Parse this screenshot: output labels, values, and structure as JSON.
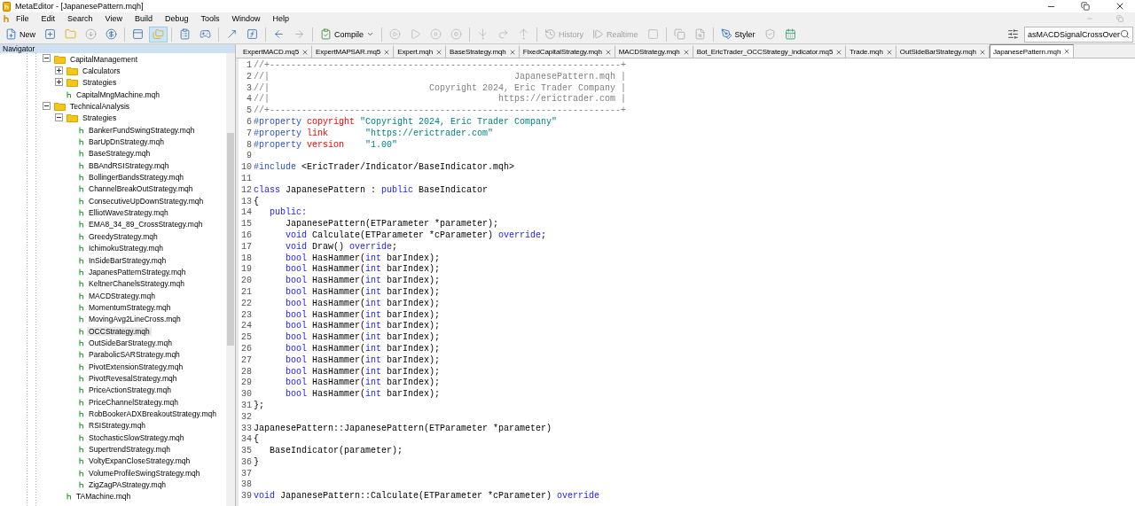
{
  "window": {
    "title": "MetaEditor - [JapanesePattern.mqh]"
  },
  "menu": [
    "File",
    "Edit",
    "Search",
    "View",
    "Build",
    "Debug",
    "Tools",
    "Window",
    "Help"
  ],
  "toolbar": {
    "navigator_pressed": true,
    "buttons": [
      {
        "label": "New",
        "disabled": false
      },
      {
        "label": "Compile",
        "disabled": false
      },
      {
        "label": "History",
        "disabled": true
      },
      {
        "label": "Realtime",
        "disabled": true
      },
      {
        "label": "Styler",
        "disabled": false
      }
    ],
    "search": {
      "value": "asMACDSignalCrossOver"
    }
  },
  "navigator": {
    "title": "Navigator",
    "tree": [
      {
        "kind": "folder",
        "label": "CapitalManagement",
        "expanded": true,
        "selected": false,
        "children": [
          {
            "kind": "folder",
            "label": "Calculators",
            "expanded": false,
            "selected": false
          },
          {
            "kind": "folder",
            "label": "Strategies",
            "expanded": false,
            "selected": false
          },
          {
            "kind": "file",
            "label": "CapitalMngMachine.mqh",
            "selected": false
          }
        ]
      },
      {
        "kind": "folder",
        "label": "TechnicalAnalysis",
        "expanded": true,
        "selected": false,
        "children": [
          {
            "kind": "folder",
            "label": "Strategies",
            "expanded": true,
            "selected": false,
            "children": [
              {
                "kind": "file",
                "label": "BankerFundSwingStrategy.mqh",
                "selected": false
              },
              {
                "kind": "file",
                "label": "BarUpDnStrategy.mqh",
                "selected": false
              },
              {
                "kind": "file",
                "label": "BaseStrategy.mqh",
                "selected": false
              },
              {
                "kind": "file",
                "label": "BBAndRSIStrategy.mqh",
                "selected": false
              },
              {
                "kind": "file",
                "label": "BollingerBandsStrategy.mqh",
                "selected": false
              },
              {
                "kind": "file",
                "label": "ChannelBreakOutStrategy.mqh",
                "selected": false
              },
              {
                "kind": "file",
                "label": "ConsecutiveUpDownStrategy.mqh",
                "selected": false
              },
              {
                "kind": "file",
                "label": "ElliotWaveStrategy.mqh",
                "selected": false
              },
              {
                "kind": "file",
                "label": "EMA8_34_89_CrossStrategy.mqh",
                "selected": false
              },
              {
                "kind": "file",
                "label": "GreedyStrategy.mqh",
                "selected": false
              },
              {
                "kind": "file",
                "label": "IchimokuStrategy.mqh",
                "selected": false
              },
              {
                "kind": "file",
                "label": "InSideBarStrategy.mqh",
                "selected": false
              },
              {
                "kind": "file",
                "label": "JapanesPatternStrategy.mqh",
                "selected": false
              },
              {
                "kind": "file",
                "label": "KeltnerChanelsStrategy.mqh",
                "selected": false
              },
              {
                "kind": "file",
                "label": "MACDStrategy.mqh",
                "selected": false
              },
              {
                "kind": "file",
                "label": "MomentumStrategy.mqh",
                "selected": false
              },
              {
                "kind": "file",
                "label": "MovingAvg2LineCross.mqh",
                "selected": false
              },
              {
                "kind": "file",
                "label": "OCCStrategy.mqh",
                "selected": true
              },
              {
                "kind": "file",
                "label": "OutSideBarStrategy.mqh",
                "selected": false
              },
              {
                "kind": "file",
                "label": "ParabolicSARStrategy.mqh",
                "selected": false
              },
              {
                "kind": "file",
                "label": "PivotExtensionStrategy.mqh",
                "selected": false
              },
              {
                "kind": "file",
                "label": "PivotRevesalStrategy.mqh",
                "selected": false
              },
              {
                "kind": "file",
                "label": "PriceActionStrategy.mqh",
                "selected": false
              },
              {
                "kind": "file",
                "label": "PriceChannelStrategy.mqh",
                "selected": false
              },
              {
                "kind": "file",
                "label": "RobBookerADXBreakoutStrategy.mqh",
                "selected": false
              },
              {
                "kind": "file",
                "label": "RSIStrategy.mqh",
                "selected": false
              },
              {
                "kind": "file",
                "label": "StochasticSlowStrategy.mqh",
                "selected": false
              },
              {
                "kind": "file",
                "label": "SupertrendStrategy.mqh",
                "selected": false
              },
              {
                "kind": "file",
                "label": "VoltyExpanCloseStrategy.mqh",
                "selected": false
              },
              {
                "kind": "file",
                "label": "VolumeProfileSwingStrategy.mqh",
                "selected": false
              },
              {
                "kind": "file",
                "label": "ZigZagPAStrategy.mqh",
                "selected": false
              }
            ]
          },
          {
            "kind": "file",
            "label": "TAMachine.mqh",
            "selected": false
          }
        ]
      }
    ]
  },
  "tabs": [
    {
      "label": "ExpertMACD.mq5",
      "selected": false
    },
    {
      "label": "ExpertMAPSAR.mq5",
      "selected": false
    },
    {
      "label": "Expert.mqh",
      "selected": false
    },
    {
      "label": "BaseStrategy.mqh",
      "selected": false
    },
    {
      "label": "FixedCapitalStrategy.mqh",
      "selected": false
    },
    {
      "label": "MACDStrategy.mqh",
      "selected": false
    },
    {
      "label": "Bot_EricTrader_OCCStrategy_indicator.mq5",
      "selected": false
    },
    {
      "label": "Trade.mqh",
      "selected": false
    },
    {
      "label": "OutSideBarStrategy.mqh",
      "selected": false
    },
    {
      "label": "JapanesePattern.mqh",
      "selected": true
    }
  ],
  "code": [
    {
      "number": "1",
      "tokens": [
        {
          "kind": "comment",
          "text": "//+------------------------------------------------------------------+"
        }
      ]
    },
    {
      "number": "2",
      "tokens": [
        {
          "kind": "comment",
          "text": "//|                                              JapanesePattern.mqh |"
        }
      ]
    },
    {
      "number": "3",
      "tokens": [
        {
          "kind": "comment",
          "text": "//|                              Copyright 2024, Eric Trader Company |"
        }
      ]
    },
    {
      "number": "4",
      "tokens": [
        {
          "kind": "comment",
          "text": "//|                                           https://erictrader.com |"
        }
      ]
    },
    {
      "number": "5",
      "tokens": [
        {
          "kind": "comment",
          "text": "//+------------------------------------------------------------------+"
        }
      ]
    },
    {
      "number": "6",
      "tokens": [
        {
          "kind": "preproc",
          "text": "#property"
        },
        {
          "kind": "name",
          "text": " copyright "
        },
        {
          "kind": "string",
          "text": "\"Copyright 2024, Eric Trader Company\""
        }
      ]
    },
    {
      "number": "7",
      "tokens": [
        {
          "kind": "preproc",
          "text": "#property"
        },
        {
          "kind": "name",
          "text": " link       "
        },
        {
          "kind": "string",
          "text": "\"https://erictrader.com\""
        }
      ]
    },
    {
      "number": "8",
      "tokens": [
        {
          "kind": "preproc",
          "text": "#property"
        },
        {
          "kind": "name",
          "text": " version    "
        },
        {
          "kind": "string",
          "text": "\"1.00\""
        }
      ]
    },
    {
      "number": "9"
    },
    {
      "number": "10",
      "tokens": [
        {
          "kind": "preproc",
          "text": "#include"
        },
        {
          "kind": "plain",
          "text": " <EricTrader/Indicator/BaseIndicator.mqh>"
        }
      ]
    },
    {
      "number": "11"
    },
    {
      "number": "12",
      "tokens": [
        {
          "kind": "keyword",
          "text": "class"
        },
        {
          "kind": "plain",
          "text": " JapanesePattern : "
        },
        {
          "kind": "keyword",
          "text": "public"
        },
        {
          "kind": "plain",
          "text": " BaseIndicator"
        }
      ]
    },
    {
      "number": "13",
      "tokens": [
        {
          "kind": "plain",
          "text": "{"
        }
      ]
    },
    {
      "number": "14",
      "tokens": [
        {
          "kind": "keyword",
          "text": "   public:"
        }
      ]
    },
    {
      "number": "15",
      "tokens": [
        {
          "kind": "plain",
          "text": "      JapanesePattern(ETParameter *parameter);"
        }
      ]
    },
    {
      "number": "16",
      "tokens": [
        {
          "kind": "keyword",
          "text": "      void"
        },
        {
          "kind": "plain",
          "text": " Calculate(ETParameter *cParameter) "
        },
        {
          "kind": "keyword",
          "text": "override"
        },
        {
          "kind": "plain",
          "text": ";"
        }
      ]
    },
    {
      "number": "17",
      "tokens": [
        {
          "kind": "keyword",
          "text": "      void"
        },
        {
          "kind": "plain",
          "text": " Draw() "
        },
        {
          "kind": "keyword",
          "text": "override"
        },
        {
          "kind": "plain",
          "text": ";"
        }
      ]
    },
    {
      "number": "18",
      "tokens": [
        {
          "kind": "keyword",
          "text": "      bool"
        },
        {
          "kind": "plain",
          "text": " HasHammer("
        },
        {
          "kind": "keyword",
          "text": "int"
        },
        {
          "kind": "plain",
          "text": " barIndex);"
        }
      ]
    },
    {
      "number": "19",
      "tokens": [
        {
          "kind": "keyword",
          "text": "      bool"
        },
        {
          "kind": "plain",
          "text": " HasHammer("
        },
        {
          "kind": "keyword",
          "text": "int"
        },
        {
          "kind": "plain",
          "text": " barIndex);"
        }
      ]
    },
    {
      "number": "20",
      "tokens": [
        {
          "kind": "keyword",
          "text": "      bool"
        },
        {
          "kind": "plain",
          "text": " HasHammer("
        },
        {
          "kind": "keyword",
          "text": "int"
        },
        {
          "kind": "plain",
          "text": " barIndex);"
        }
      ]
    },
    {
      "number": "21",
      "tokens": [
        {
          "kind": "keyword",
          "text": "      bool"
        },
        {
          "kind": "plain",
          "text": " HasHammer("
        },
        {
          "kind": "keyword",
          "text": "int"
        },
        {
          "kind": "plain",
          "text": " barIndex);"
        }
      ]
    },
    {
      "number": "22",
      "tokens": [
        {
          "kind": "keyword",
          "text": "      bool"
        },
        {
          "kind": "plain",
          "text": " HasHammer("
        },
        {
          "kind": "keyword",
          "text": "int"
        },
        {
          "kind": "plain",
          "text": " barIndex);"
        }
      ]
    },
    {
      "number": "23",
      "tokens": [
        {
          "kind": "keyword",
          "text": "      bool"
        },
        {
          "kind": "plain",
          "text": " HasHammer("
        },
        {
          "kind": "keyword",
          "text": "int"
        },
        {
          "kind": "plain",
          "text": " barIndex);"
        }
      ]
    },
    {
      "number": "24",
      "tokens": [
        {
          "kind": "keyword",
          "text": "      bool"
        },
        {
          "kind": "plain",
          "text": " HasHammer("
        },
        {
          "kind": "keyword",
          "text": "int"
        },
        {
          "kind": "plain",
          "text": " barIndex);"
        }
      ]
    },
    {
      "number": "25",
      "tokens": [
        {
          "kind": "keyword",
          "text": "      bool"
        },
        {
          "kind": "plain",
          "text": " HasHammer("
        },
        {
          "kind": "keyword",
          "text": "int"
        },
        {
          "kind": "plain",
          "text": " barIndex);"
        }
      ]
    },
    {
      "number": "26",
      "tokens": [
        {
          "kind": "keyword",
          "text": "      bool"
        },
        {
          "kind": "plain",
          "text": " HasHammer("
        },
        {
          "kind": "keyword",
          "text": "int"
        },
        {
          "kind": "plain",
          "text": " barIndex);"
        }
      ]
    },
    {
      "number": "27",
      "tokens": [
        {
          "kind": "keyword",
          "text": "      bool"
        },
        {
          "kind": "plain",
          "text": " HasHammer("
        },
        {
          "kind": "keyword",
          "text": "int"
        },
        {
          "kind": "plain",
          "text": " barIndex);"
        }
      ]
    },
    {
      "number": "28",
      "tokens": [
        {
          "kind": "keyword",
          "text": "      bool"
        },
        {
          "kind": "plain",
          "text": " HasHammer("
        },
        {
          "kind": "keyword",
          "text": "int"
        },
        {
          "kind": "plain",
          "text": " barIndex);"
        }
      ]
    },
    {
      "number": "29",
      "tokens": [
        {
          "kind": "keyword",
          "text": "      bool"
        },
        {
          "kind": "plain",
          "text": " HasHammer("
        },
        {
          "kind": "keyword",
          "text": "int"
        },
        {
          "kind": "plain",
          "text": " barIndex);"
        }
      ]
    },
    {
      "number": "30",
      "tokens": [
        {
          "kind": "keyword",
          "text": "      bool"
        },
        {
          "kind": "plain",
          "text": " HasHammer("
        },
        {
          "kind": "keyword",
          "text": "int"
        },
        {
          "kind": "plain",
          "text": " barIndex);"
        }
      ]
    },
    {
      "number": "31",
      "tokens": [
        {
          "kind": "plain",
          "text": "};"
        }
      ]
    },
    {
      "number": "32"
    },
    {
      "number": "33",
      "tokens": [
        {
          "kind": "plain",
          "text": "JapanesePattern::JapanesePattern(ETParameter *parameter)"
        }
      ]
    },
    {
      "number": "34",
      "tokens": [
        {
          "kind": "plain",
          "text": "{"
        }
      ]
    },
    {
      "number": "35",
      "tokens": [
        {
          "kind": "plain",
          "text": "   BaseIndicator(parameter);"
        }
      ]
    },
    {
      "number": "36",
      "tokens": [
        {
          "kind": "plain",
          "text": "}"
        }
      ]
    },
    {
      "number": "37"
    },
    {
      "number": "38"
    },
    {
      "number": "39",
      "tokens": [
        {
          "kind": "keyword",
          "text": "void"
        },
        {
          "kind": "plain",
          "text": " JapanesePattern::Calculate(ETParameter *cParameter) "
        },
        {
          "kind": "keyword",
          "text": "override"
        }
      ]
    }
  ]
}
